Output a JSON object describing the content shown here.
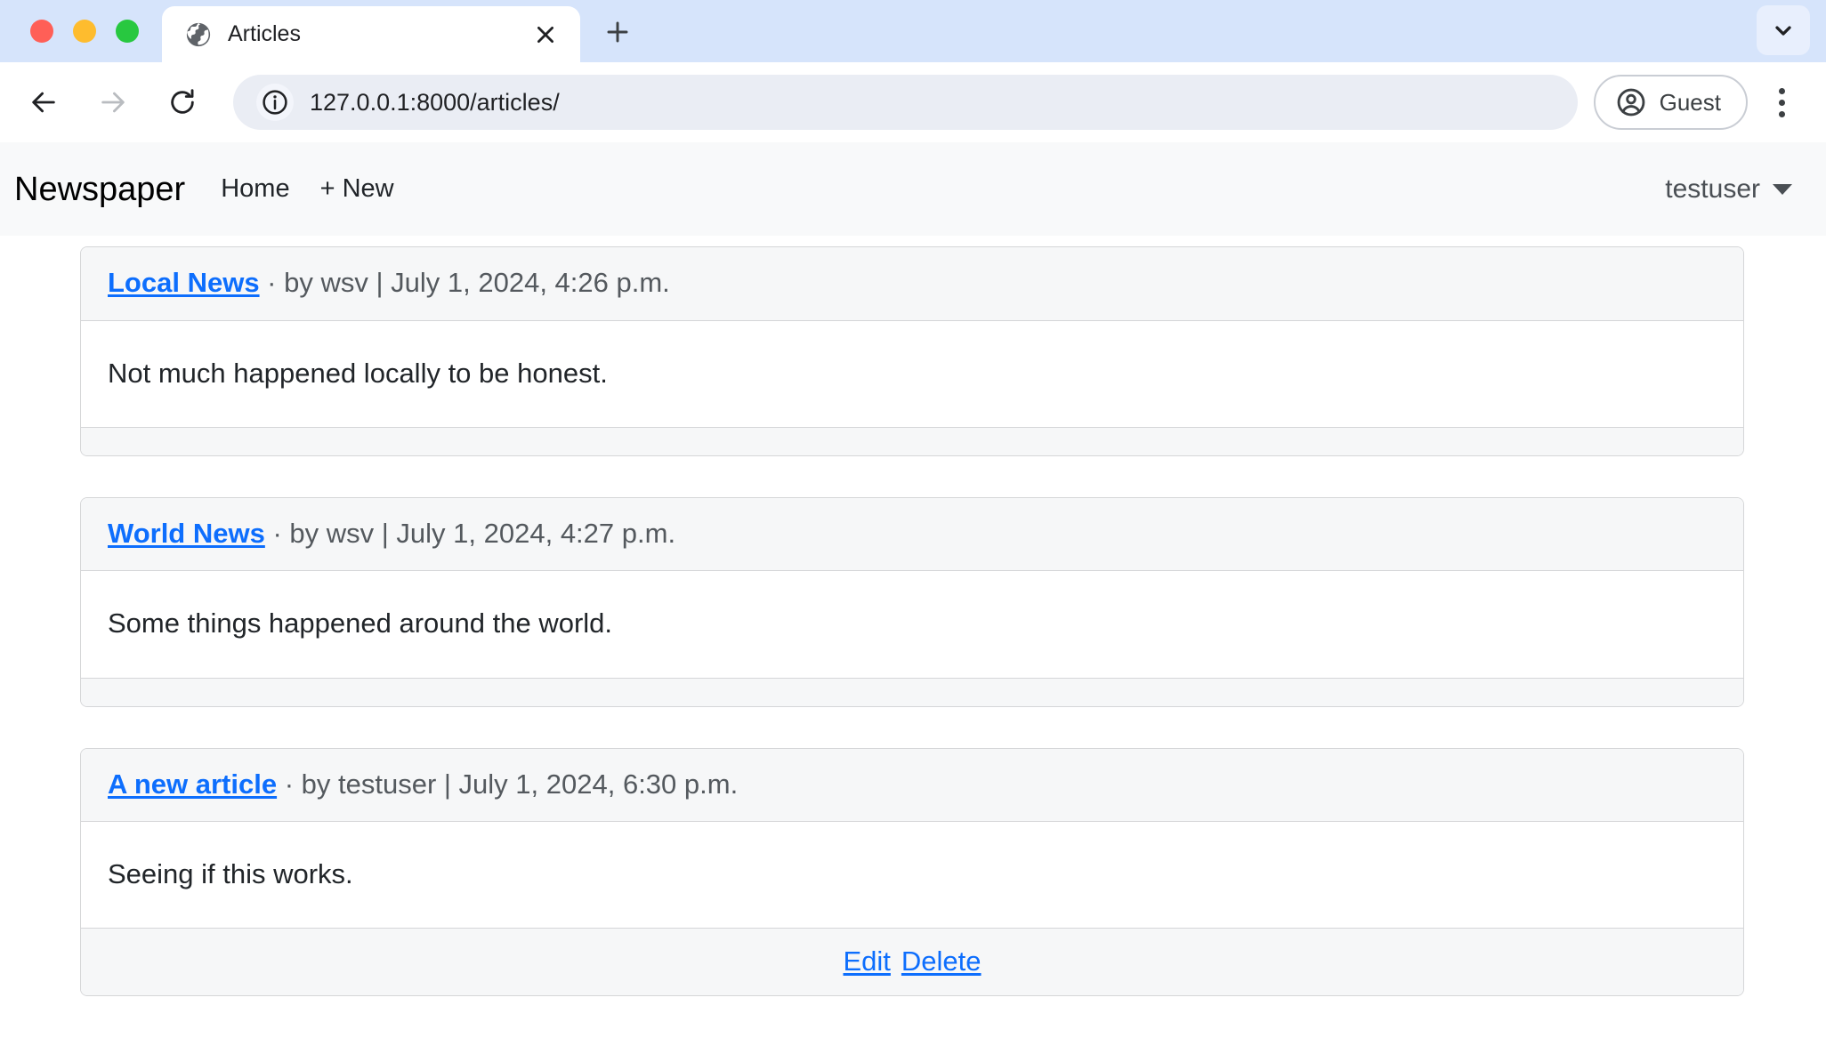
{
  "browser": {
    "window_controls": [
      "close",
      "minimize",
      "maximize"
    ],
    "tab": {
      "title": "Articles",
      "favicon": "globe-icon",
      "close_label": "×"
    },
    "new_tab_label": "+",
    "expand_label": "chevron-down-icon",
    "toolbar": {
      "back_label": "←",
      "forward_label": "→",
      "reload_label": "↻",
      "site_info_icon": "info-circle-icon",
      "url": "127.0.0.1:8000/articles/",
      "url_placeholder": "Search Google or type a URL",
      "profile_name": "Guest",
      "profile_icon": "account-circle-icon",
      "menu_icon": "three-dot-menu-icon"
    }
  },
  "site": {
    "brand": "Newspaper",
    "nav_links": [
      {
        "label": "Home",
        "name": "nav-link-home"
      },
      {
        "label": "+ New",
        "name": "nav-link-new"
      }
    ],
    "user_menu": {
      "username": "testuser",
      "caret": "caret-down-icon"
    }
  },
  "articles": [
    {
      "title": "Local News",
      "separator": " · ",
      "meta": "by wsv | July 1, 2024, 4:26 p.m.",
      "body": "Not much happened locally to be honest.",
      "actions": []
    },
    {
      "title": "World News",
      "separator": " · ",
      "meta": "by wsv | July 1, 2024, 4:27 p.m.",
      "body": "Some things happened around the world.",
      "actions": []
    },
    {
      "title": "A new article",
      "separator": " · ",
      "meta": "by testuser | July 1, 2024, 6:30 p.m.",
      "body": "Seeing if this works.",
      "actions": [
        {
          "label": "Edit",
          "name": "edit-article-link"
        },
        {
          "label": "Delete",
          "name": "delete-article-link"
        }
      ]
    }
  ],
  "colors": {
    "link": "#0d6efd",
    "chrome_tabstrip": "#d6e4fb",
    "navbar_bg": "#f8f9fa",
    "card_header_bg": "#f6f7f8",
    "card_border": "#d5d6d8",
    "traffic_red": "#ff5f57",
    "traffic_yellow": "#febc2e",
    "traffic_green": "#28c840"
  }
}
